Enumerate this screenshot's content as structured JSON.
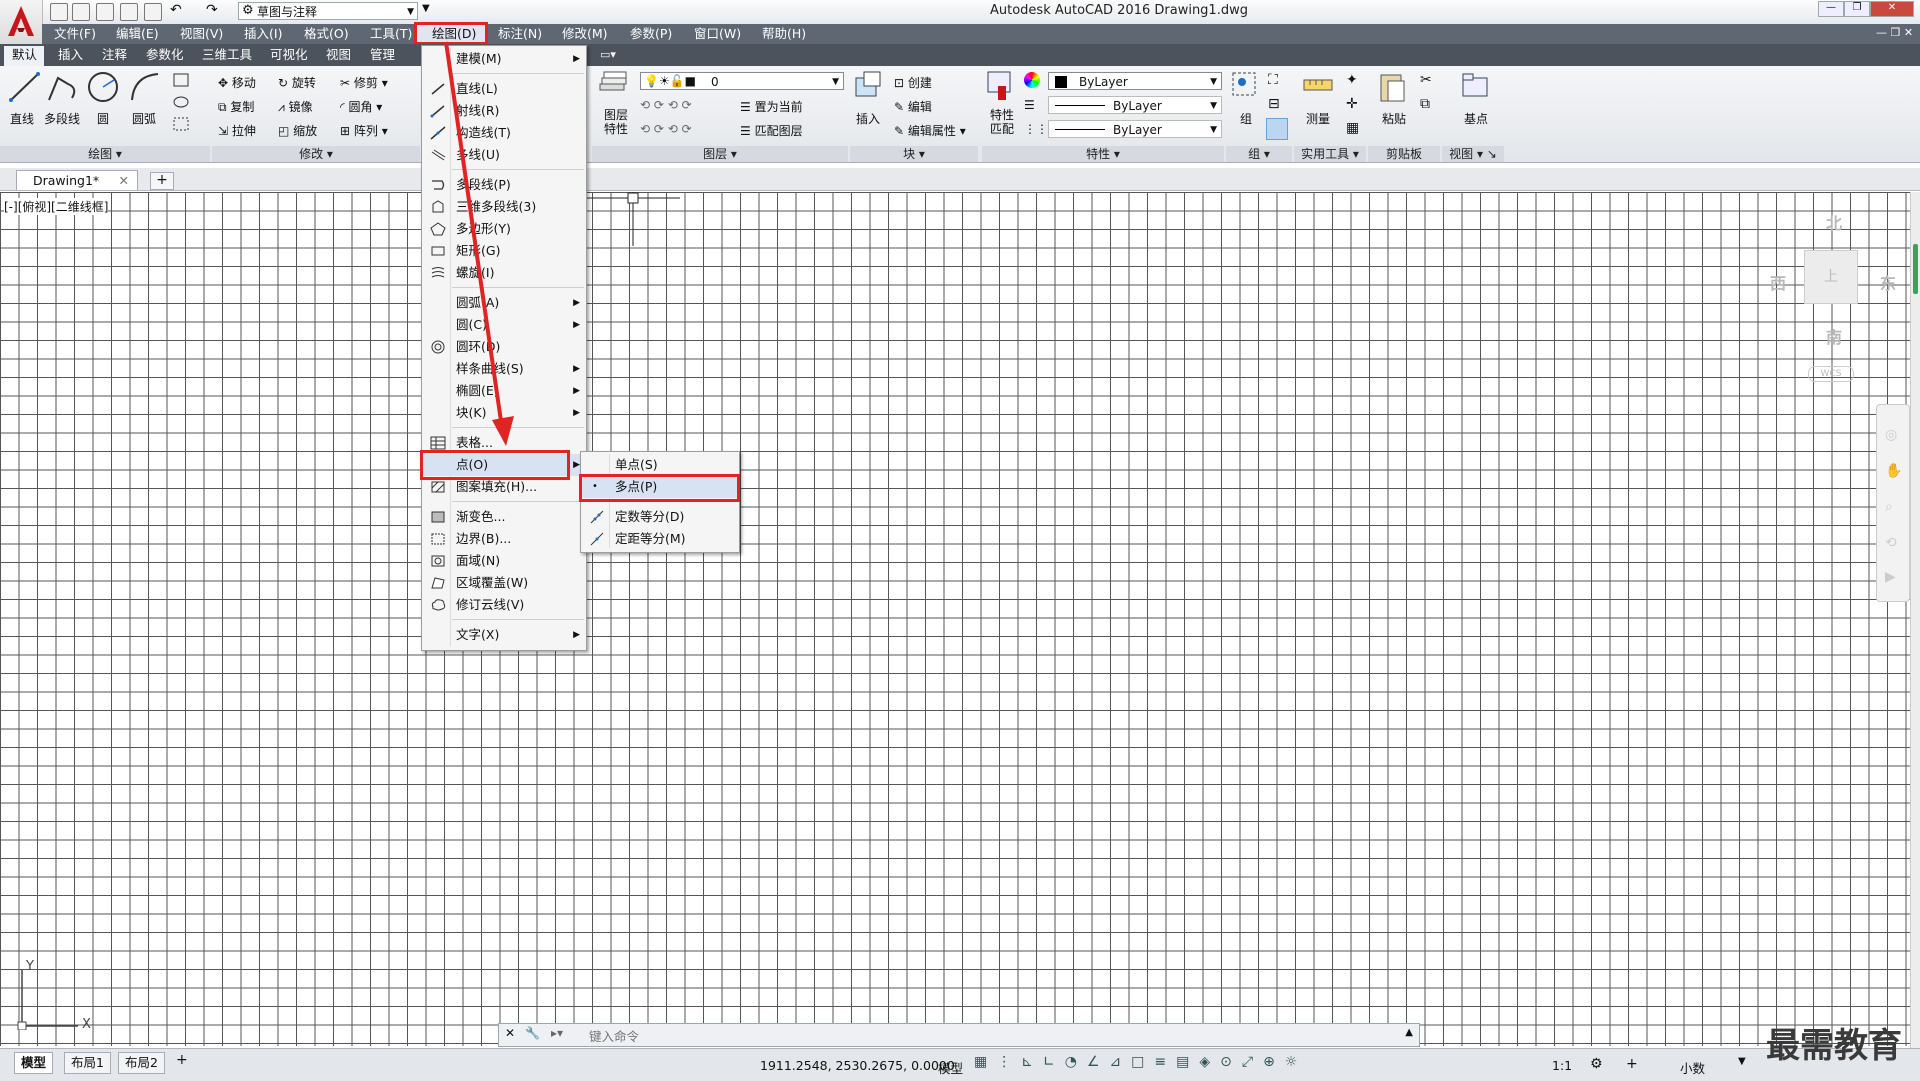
{
  "window": {
    "title": "Autodesk AutoCAD 2016    Drawing1.dwg",
    "workspace": "草图与注释"
  },
  "menubar": {
    "items": [
      "文件(F)",
      "编辑(E)",
      "视图(V)",
      "插入(I)",
      "格式(O)",
      "工具(T)",
      "绘图(D)",
      "标注(N)",
      "修改(M)",
      "参数(P)",
      "窗口(W)",
      "帮助(H)"
    ]
  },
  "ribbon_tabs": [
    "默认",
    "插入",
    "注释",
    "参数化",
    "三维工具",
    "可视化",
    "视图",
    "管理"
  ],
  "ribbon": {
    "draw": {
      "title": "绘图",
      "line": "直线",
      "polyline": "多段线",
      "circle": "圆",
      "arc": "圆弧"
    },
    "modify": {
      "title": "修改",
      "move": "移动",
      "rotate": "旋转",
      "trim": "修剪",
      "copy": "复制",
      "mirror": "镜像",
      "fillet": "圆角",
      "stretch": "拉伸",
      "scale": "缩放",
      "array": "阵列"
    },
    "layers": {
      "title": "图层",
      "layer_props": "图层\n特性",
      "current_layer": "0",
      "set_current": "置为当前",
      "match_layer": "匹配图层"
    },
    "block": {
      "title": "块",
      "insert": "插入",
      "create": "创建",
      "edit": "编辑",
      "edit_attr": "编辑属性"
    },
    "properties": {
      "title": "特性",
      "match": "特性\n匹配",
      "color": "ByLayer",
      "linetype": "ByLayer",
      "lineweight": "ByLayer"
    },
    "groups": {
      "title": "组",
      "group": "组"
    },
    "utilities": {
      "title": "实用工具",
      "measure": "测量"
    },
    "clipboard": {
      "title": "剪贴板",
      "paste": "粘贴"
    },
    "view": {
      "title": "视图",
      "base": "基点"
    }
  },
  "doc_tabs": {
    "active": "Drawing1*"
  },
  "viewport_label": "[-][俯视][二维线框]",
  "draw_menu": {
    "items": [
      {
        "label": "建模(M)",
        "sub": true
      },
      {
        "label": "直线(L)"
      },
      {
        "label": "射线(R)"
      },
      {
        "label": "构造线(T)"
      },
      {
        "label": "多线(U)"
      },
      {
        "label": "多段线(P)"
      },
      {
        "label": "三维多段线(3)"
      },
      {
        "label": "多边形(Y)"
      },
      {
        "label": "矩形(G)"
      },
      {
        "label": "螺旋(I)"
      },
      {
        "label": "圆弧(A)",
        "sub": true
      },
      {
        "label": "圆(C)",
        "sub": true
      },
      {
        "label": "圆环(D)"
      },
      {
        "label": "样条曲线(S)",
        "sub": true
      },
      {
        "label": "椭圆(E)",
        "sub": true
      },
      {
        "label": "块(K)",
        "sub": true
      },
      {
        "label": "表格..."
      },
      {
        "label": "点(O)",
        "sub": true
      },
      {
        "label": "图案填充(H)..."
      },
      {
        "label": "渐变色..."
      },
      {
        "label": "边界(B)..."
      },
      {
        "label": "面域(N)"
      },
      {
        "label": "区域覆盖(W)"
      },
      {
        "label": "修订云线(V)"
      },
      {
        "label": "文字(X)",
        "sub": true
      }
    ]
  },
  "point_submenu": {
    "items": [
      {
        "label": "单点(S)"
      },
      {
        "label": "多点(P)"
      },
      {
        "label": "定数等分(D)"
      },
      {
        "label": "定距等分(M)"
      }
    ]
  },
  "viewcube": {
    "north": "北",
    "south": "南",
    "east": "东",
    "west": "西",
    "top": "上",
    "wcs": "WCS"
  },
  "command_line": {
    "placeholder": "键入命令"
  },
  "layout_tabs": [
    "模型",
    "布局1",
    "布局2"
  ],
  "status": {
    "coords": "1911.2548, 2530.2675, 0.0000",
    "mode": "模型",
    "scale": "1:1",
    "units": "小数"
  },
  "watermark": "最需教育",
  "colors": {
    "highlight": "#e02424",
    "menubar": "#5f6773",
    "arrow": "#e02424"
  }
}
